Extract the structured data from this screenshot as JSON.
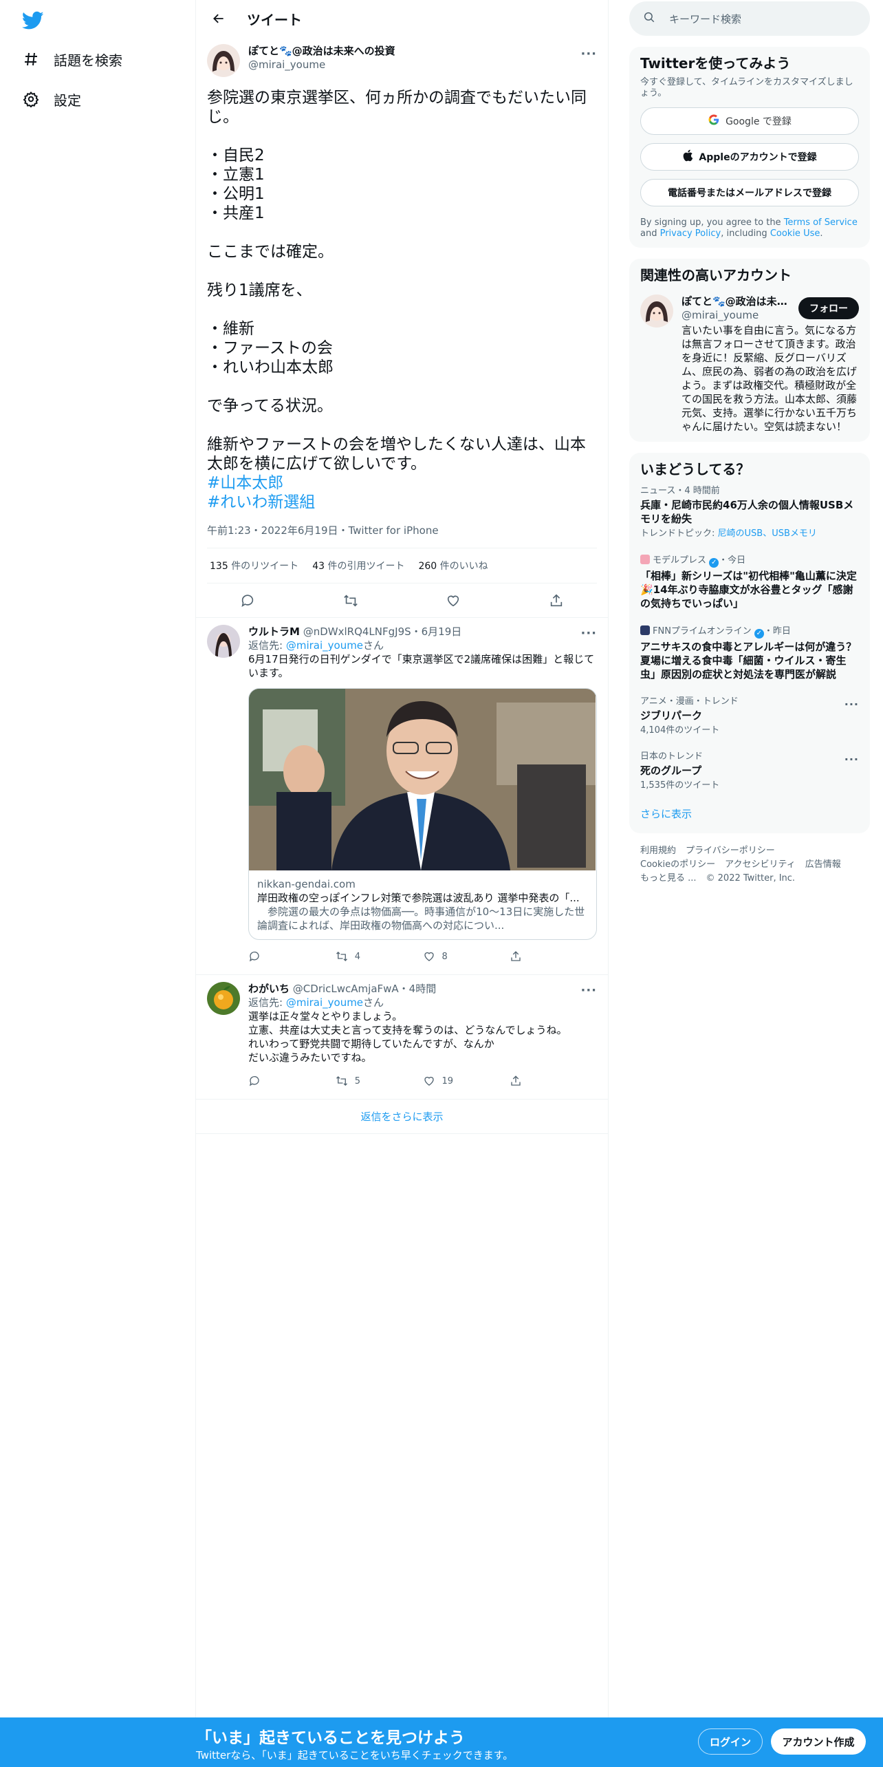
{
  "nav": {
    "explore_label": "話題を検索",
    "settings_label": "設定"
  },
  "header": {
    "title": "ツイート"
  },
  "focal_tweet": {
    "display_name": "ぽてと🐾@政治は未来への投資",
    "handle": "@mirai_youme",
    "text": "参院選の東京選挙区、何ヵ所かの調査でもだいたい同じ。\n\n・自民2\n・立憲1\n・公明1\n・共産1\n\nここまでは確定。\n\n残り1議席を、\n\n・維新\n・ファーストの会\n・れいわ山本太郎\n\nで争ってる状況。\n\n維新やファーストの会を増やしたくない人達は、山本太郎を横に広げて欲しいです。",
    "hashtag_1": "#山本太郎",
    "hashtag_2": "#れいわ新選組",
    "meta": "午前1:23・2022年6月19日・Twitter for iPhone",
    "retweets": "135",
    "retweets_label": "件のリツイート",
    "quotes": "43",
    "quotes_label": "件の引用ツイート",
    "likes": "260",
    "likes_label": "件のいいね"
  },
  "replies": [
    {
      "display_name": "ウルトラM",
      "handle": "@nDWxlRQ4LNFgJ9S",
      "time": "・6月19日",
      "reply_to_prefix": "返信先: ",
      "reply_to_handle": "@mirai_youme",
      "reply_to_suffix": "さん",
      "text": "6月17日発行の日刊ゲンダイで「東京選挙区で2議席確保は困難」と報じています。",
      "card_domain": "nikkan-gendai.com",
      "card_title": "岸田政権の空っぽインフレ対策で参院選は波乱あり 選挙中発表の「...",
      "card_desc": "　参院選の最大の争点は物価高──。時事通信が10～13日に実施した世論調査によれば、岸田政権の物価高への対応につい...",
      "retweets": "4",
      "likes": "8"
    },
    {
      "display_name": "わがいち",
      "handle": "@CDricLwcAmjaFwA",
      "time": "・4時間",
      "reply_to_prefix": "返信先: ",
      "reply_to_handle": "@mirai_youme",
      "reply_to_suffix": "さん",
      "text": "選挙は正々堂々とやりましょう。\n立憲、共産は大丈夫と言って支持を奪うのは、どうなんでしょうね。\nれいわって野党共闘で期待していたんですが、なんか\nだいぶ違うみたいですね。",
      "retweets": "5",
      "likes": "19"
    }
  ],
  "show_more_replies": "返信をさらに表示",
  "search": {
    "placeholder": "キーワード検索"
  },
  "signup_panel": {
    "title": "Twitterを使ってみよう",
    "subtitle": "今すぐ登録して、タイムラインをカスタマイズしましょう。",
    "google": "Google で登録",
    "apple": "Appleのアカウントで登録",
    "phone": "電話番号またはメールアドレスで登録",
    "terms_1": "By signing up, you agree to the ",
    "terms_link_1": "Terms of Service",
    "terms_2": " and ",
    "terms_link_2": "Privacy Policy",
    "terms_3": ", including ",
    "terms_link_3": "Cookie Use",
    "terms_4": "."
  },
  "related": {
    "title": "関連性の高いアカウント",
    "name": "ぽてと🐾@政治は未来への投資",
    "handle": "@mirai_youme",
    "follow": "フォロー",
    "bio": "言いたい事を自由に言う。気になる方は無言フォローさせて頂きます。政治を身近に！反緊縮、反グローバリズム、庶民の為、弱者の為の政治を広げよう。まずは政権交代。積極財政が全ての国民を救う方法。山本太郎、須藤元気、支持。選挙に行かない五千万ちゃんに届けたい。空気は読まない！"
  },
  "trends": {
    "title": "いまどうしてる？",
    "items": [
      {
        "category": "ニュース・4 時間前",
        "title": "兵庫・尼崎市民約46万人余の個人情報USBメモリを紛失",
        "sub_prefix": "トレンドトピック: ",
        "sub_links": "尼崎のUSB、USBメモリ"
      },
      {
        "source": "モデルプレス",
        "time": "・今日",
        "title": "「相棒」新シリーズは\"初代相棒\"亀山薫に決定🎉14年ぶり寺脇康文が水谷豊とタッグ「感謝の気持ちでいっぱい」"
      },
      {
        "source": "FNNプライムオンライン",
        "time": "・昨日",
        "title": "アニサキスの食中毒とアレルギーは何が違う？夏場に増える食中毒「細菌・ウイルス・寄生虫」原因別の症状と対処法を専門医が解説"
      },
      {
        "category": "アニメ・漫画・トレンド",
        "title": "ジブリパーク",
        "count": "4,104件のツイート"
      },
      {
        "category": "日本のトレンド",
        "title": "死のグループ",
        "count": "1,535件のツイート"
      }
    ],
    "show_more": "さらに表示"
  },
  "footer": {
    "terms": "利用規約",
    "privacy": "プライバシーポリシー",
    "cookie": "Cookieのポリシー",
    "accessibility": "アクセシビリティ",
    "ads": "広告情報",
    "more": "もっと見る ...",
    "copyright": "© 2022 Twitter, Inc."
  },
  "bottom_bar": {
    "title": "「いま」起きていることを見つけよう",
    "subtitle": "Twitterなら、「いま」起きていることをいち早くチェックできます。",
    "login": "ログイン",
    "signup": "アカウント作成"
  },
  "colors": {
    "accent": "#1d9bf0",
    "text": "#0f1419",
    "muted": "#536471"
  }
}
